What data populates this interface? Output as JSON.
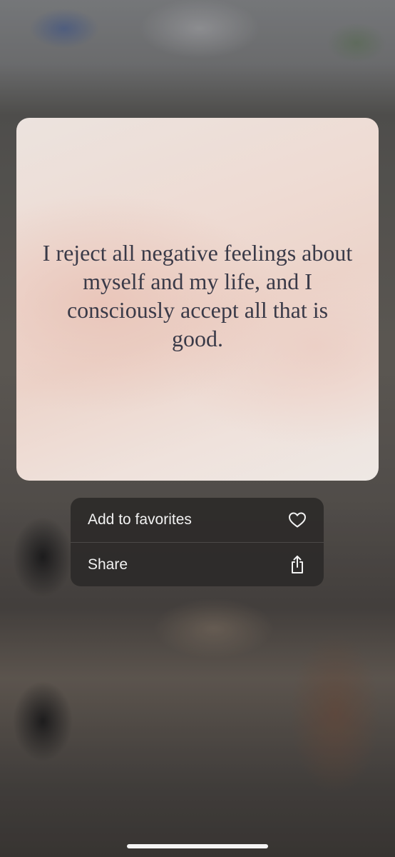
{
  "card": {
    "quote": "I reject all negative feelings about myself and my life, and I consciously accept all that is good."
  },
  "context_menu": {
    "items": [
      {
        "label": "Add to favorites",
        "icon": "heart-icon"
      },
      {
        "label": "Share",
        "icon": "share-icon"
      }
    ]
  },
  "colors": {
    "menu_background": "#2c2a29",
    "menu_text": "#f2f2f2",
    "quote_text": "#3a3a48"
  }
}
